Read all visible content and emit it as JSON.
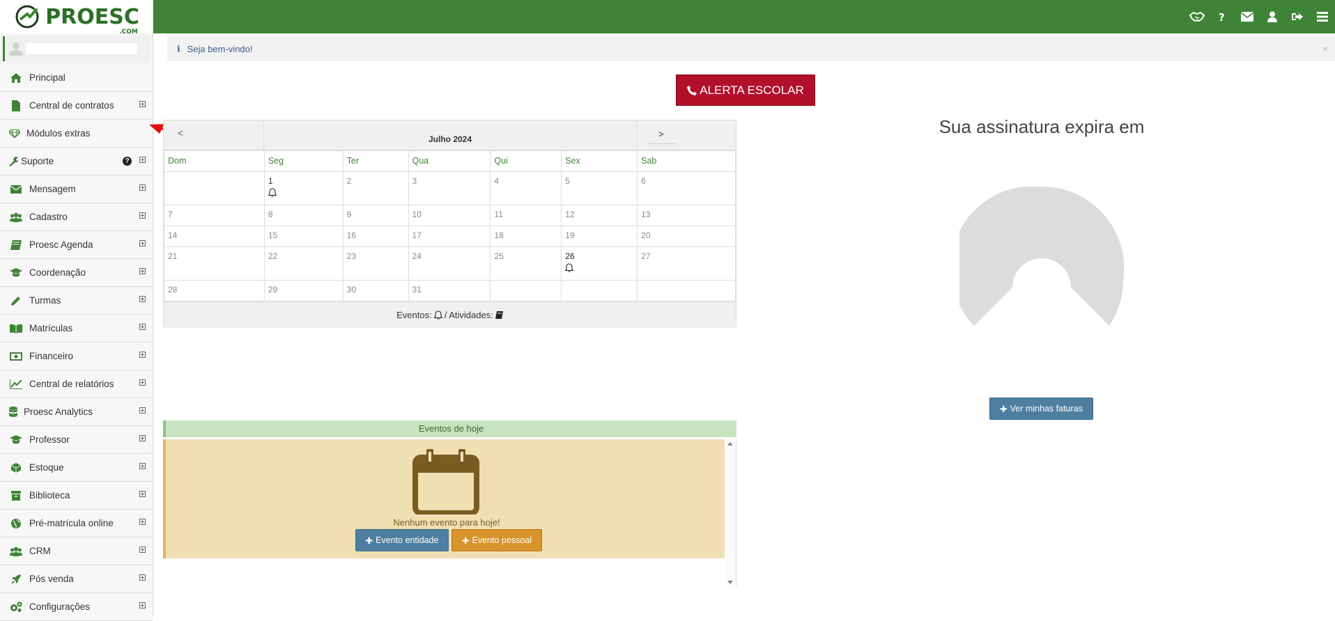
{
  "header": {
    "logo": "PROESC",
    "logo_sub": ".COM",
    "icons": [
      "handshake-icon",
      "question-icon",
      "envelope-icon",
      "user-icon",
      "sign-out-icon",
      "hamburger-icon"
    ],
    "color": "#3f8436"
  },
  "sidebar": {
    "items": [
      {
        "label": "Principal",
        "icon": "home-icon"
      },
      {
        "label": "Central de contratos",
        "icon": "file-icon"
      },
      {
        "label": "Módulos extras",
        "icon": "diamond-icon"
      },
      {
        "label": "Suporte",
        "icon": "wrench-icon"
      },
      {
        "label": "Mensagem",
        "icon": "envelope-icon"
      },
      {
        "label": "Cadastro",
        "icon": "users-icon"
      },
      {
        "label": "Proesc Agenda",
        "icon": "book-icon"
      },
      {
        "label": "Coordenação",
        "icon": "graduation-cap-icon"
      },
      {
        "label": "Turmas",
        "icon": "pencil-icon"
      },
      {
        "label": "Matrículas",
        "icon": "open-book-icon"
      },
      {
        "label": "Financeiro",
        "icon": "money-icon"
      },
      {
        "label": "Central de relatórios",
        "icon": "line-chart-icon"
      },
      {
        "label": "Proesc Analytics",
        "icon": "database-icon"
      },
      {
        "label": "Professor",
        "icon": "graduation-cap-icon"
      },
      {
        "label": "Estoque",
        "icon": "cube-icon"
      },
      {
        "label": "Biblioteca",
        "icon": "archive-icon"
      },
      {
        "label": "Pré-matrícula online",
        "icon": "globe-icon"
      },
      {
        "label": "CRM",
        "icon": "users-icon"
      },
      {
        "label": "Pós venda",
        "icon": "rocket-icon"
      },
      {
        "label": "Configurações",
        "icon": "cogs-icon"
      }
    ]
  },
  "welcome": {
    "text": "Seja bem-vindo!",
    "close": "×"
  },
  "alert_button": {
    "label": "ALERTA ESCOLAR",
    "color": "#b20f2a"
  },
  "calendar": {
    "prev": "<",
    "next": ">",
    "title": "Julho 2024",
    "days_of_week": [
      "Dom",
      "Seg",
      "Ter",
      "Qua",
      "Qui",
      "Sex",
      "Sab"
    ],
    "weeks": [
      [
        "",
        "1",
        "2",
        "3",
        "4",
        "5",
        "6"
      ],
      [
        "7",
        "8",
        "9",
        "10",
        "11",
        "12",
        "13"
      ],
      [
        "14",
        "15",
        "16",
        "17",
        "18",
        "19",
        "20"
      ],
      [
        "21",
        "22",
        "23",
        "24",
        "25",
        "26",
        "27"
      ],
      [
        "28",
        "29",
        "30",
        "31",
        "",
        "",
        ""
      ]
    ],
    "event_days": [
      "1",
      "26"
    ],
    "legend_events": "Eventos:",
    "legend_sep": "/ Atividades:"
  },
  "subscription": {
    "title": "Sua assinatura expira em",
    "faturas_button": "Ver minhas faturas"
  },
  "today_events": {
    "title": "Eventos de hoje",
    "empty": "Nenhum evento para hoje!",
    "btn_entity": "Evento entidade",
    "btn_personal": "Evento pessoal"
  }
}
